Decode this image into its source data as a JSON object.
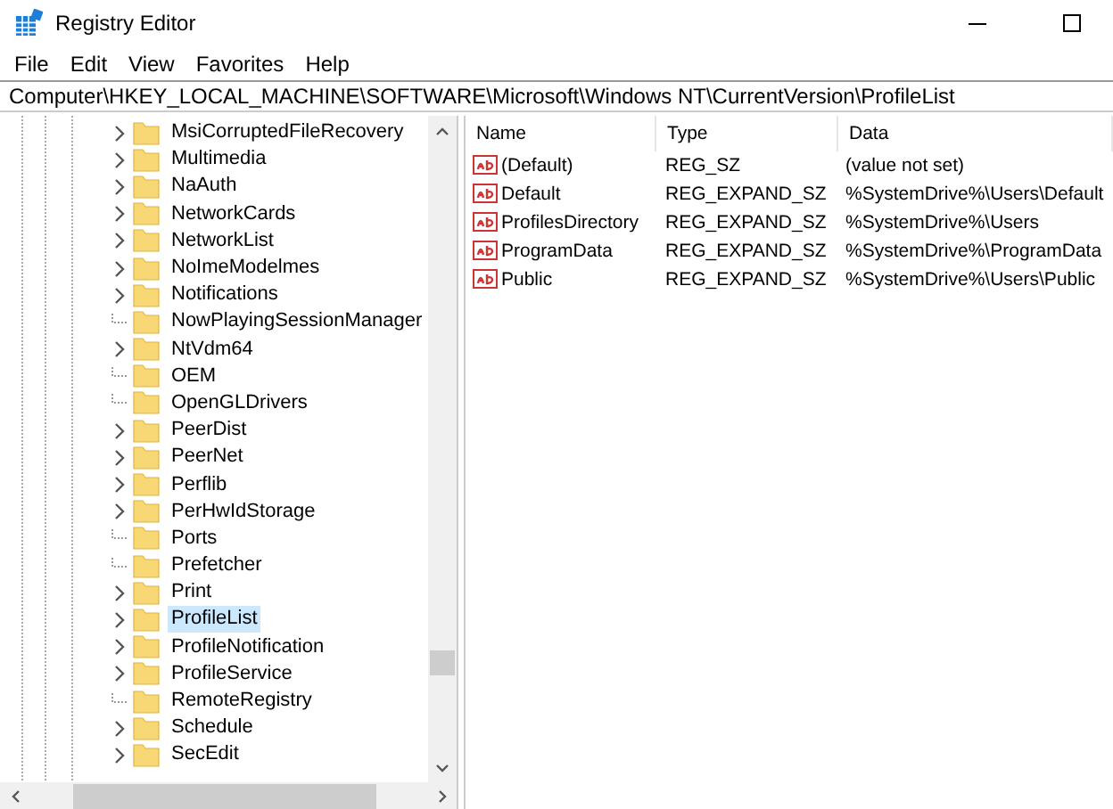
{
  "window": {
    "title": "Registry Editor"
  },
  "menu": [
    "File",
    "Edit",
    "View",
    "Favorites",
    "Help"
  ],
  "address": "Computer\\HKEY_LOCAL_MACHINE\\SOFTWARE\\Microsoft\\Windows NT\\CurrentVersion\\ProfileList",
  "tree": {
    "items": [
      {
        "label": "MsiCorruptedFileRecovery",
        "expandable": true,
        "selected": false
      },
      {
        "label": "Multimedia",
        "expandable": true,
        "selected": false
      },
      {
        "label": "NaAuth",
        "expandable": true,
        "selected": false
      },
      {
        "label": "NetworkCards",
        "expandable": true,
        "selected": false
      },
      {
        "label": "NetworkList",
        "expandable": true,
        "selected": false
      },
      {
        "label": "NoImeModelmes",
        "expandable": true,
        "selected": false
      },
      {
        "label": "Notifications",
        "expandable": true,
        "selected": false
      },
      {
        "label": "NowPlayingSessionManager",
        "expandable": false,
        "selected": false
      },
      {
        "label": "NtVdm64",
        "expandable": true,
        "selected": false
      },
      {
        "label": "OEM",
        "expandable": false,
        "selected": false
      },
      {
        "label": "OpenGLDrivers",
        "expandable": false,
        "selected": false
      },
      {
        "label": "PeerDist",
        "expandable": true,
        "selected": false
      },
      {
        "label": "PeerNet",
        "expandable": true,
        "selected": false
      },
      {
        "label": "Perflib",
        "expandable": true,
        "selected": false
      },
      {
        "label": "PerHwIdStorage",
        "expandable": true,
        "selected": false
      },
      {
        "label": "Ports",
        "expandable": false,
        "selected": false
      },
      {
        "label": "Prefetcher",
        "expandable": false,
        "selected": false
      },
      {
        "label": "Print",
        "expandable": true,
        "selected": false
      },
      {
        "label": "ProfileList",
        "expandable": true,
        "selected": true
      },
      {
        "label": "ProfileNotification",
        "expandable": true,
        "selected": false
      },
      {
        "label": "ProfileService",
        "expandable": true,
        "selected": false
      },
      {
        "label": "RemoteRegistry",
        "expandable": false,
        "selected": false
      },
      {
        "label": "Schedule",
        "expandable": true,
        "selected": false
      },
      {
        "label": "SecEdit",
        "expandable": true,
        "selected": false
      }
    ]
  },
  "values": {
    "columns": [
      "Name",
      "Type",
      "Data"
    ],
    "rows": [
      {
        "name": "(Default)",
        "type": "REG_SZ",
        "data": "(value not set)"
      },
      {
        "name": "Default",
        "type": "REG_EXPAND_SZ",
        "data": "%SystemDrive%\\Users\\Default"
      },
      {
        "name": "ProfilesDirectory",
        "type": "REG_EXPAND_SZ",
        "data": "%SystemDrive%\\Users"
      },
      {
        "name": "ProgramData",
        "type": "REG_EXPAND_SZ",
        "data": "%SystemDrive%\\ProgramData"
      },
      {
        "name": "Public",
        "type": "REG_EXPAND_SZ",
        "data": "%SystemDrive%\\Users\\Public"
      }
    ]
  }
}
